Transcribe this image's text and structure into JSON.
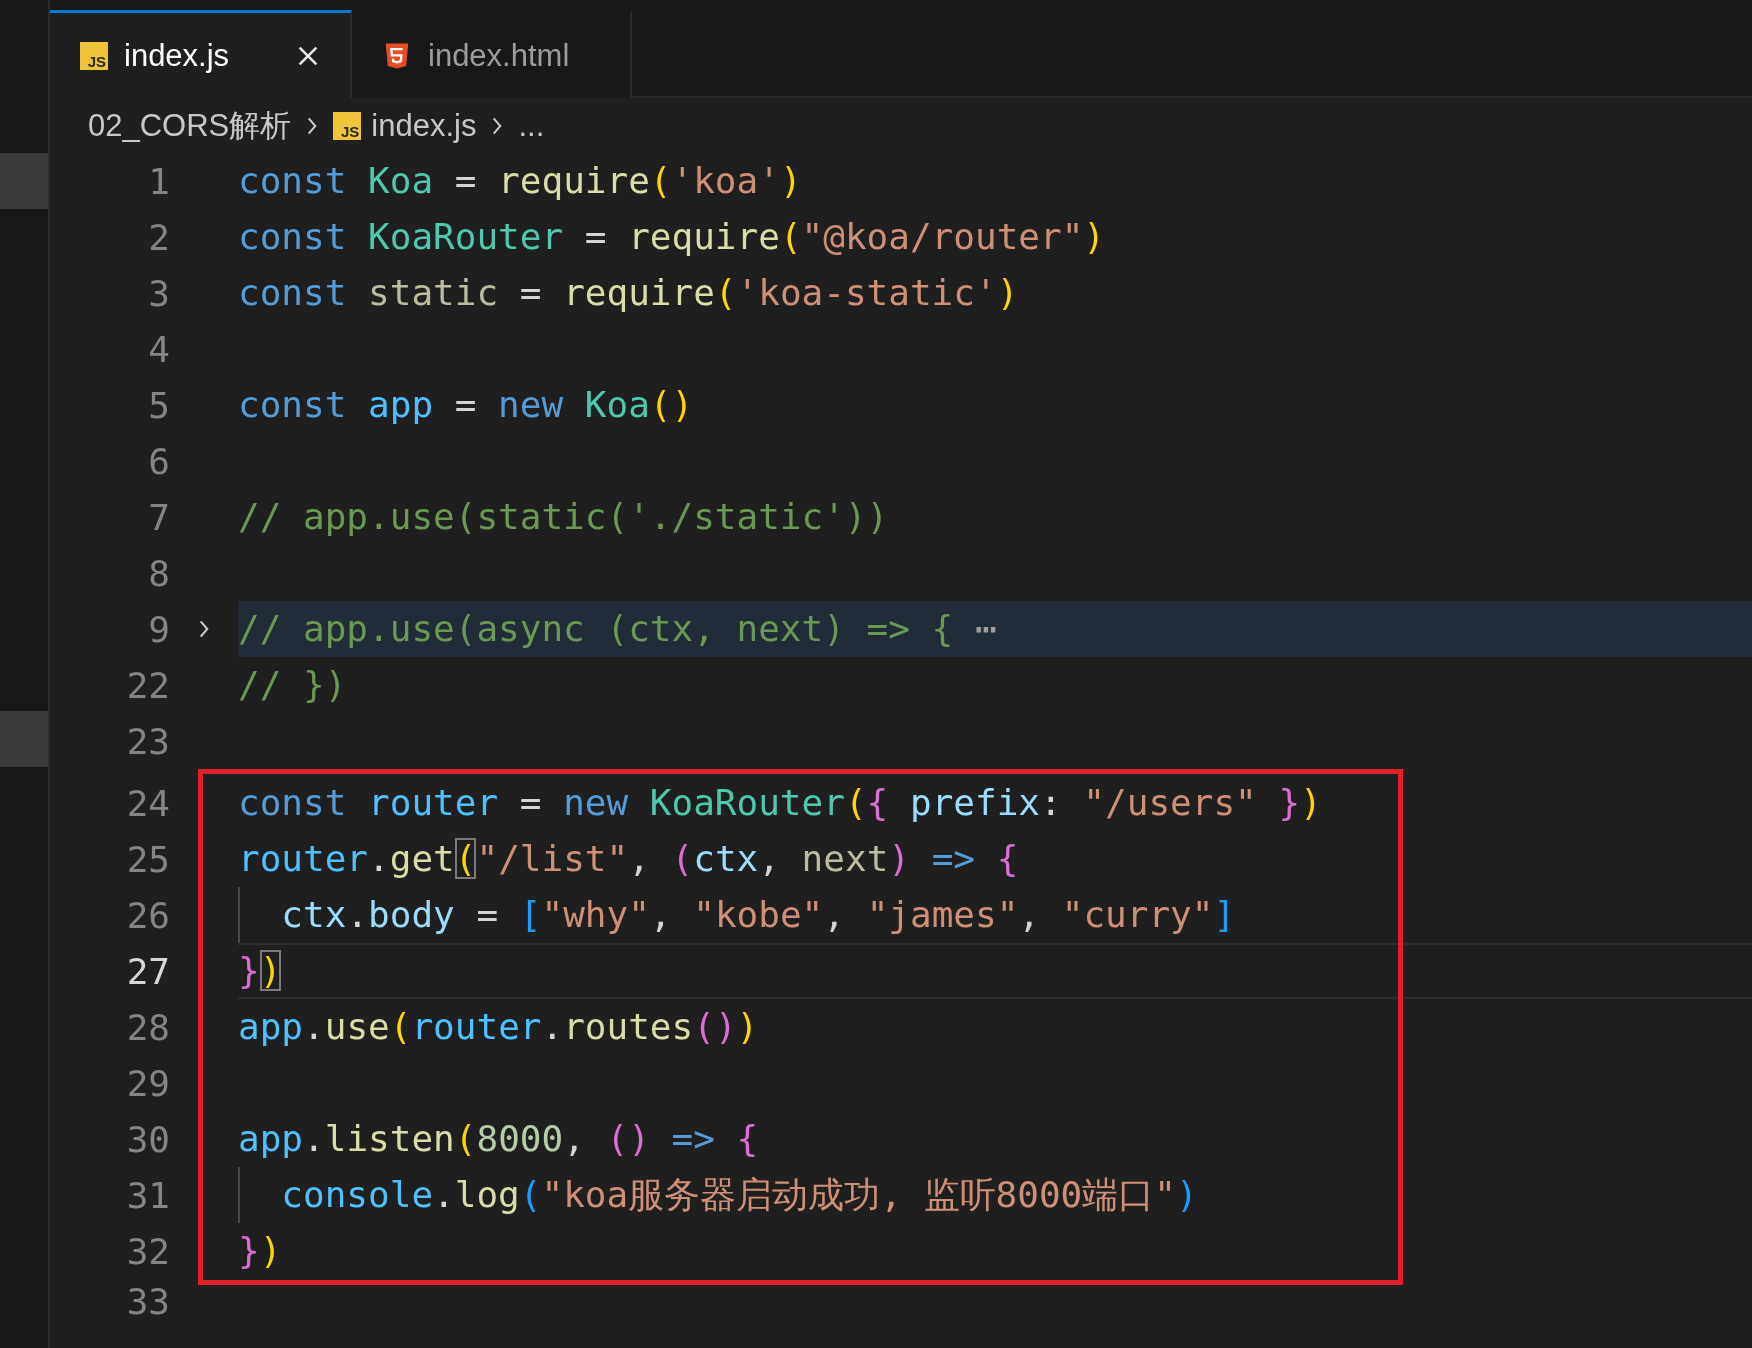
{
  "tabs": [
    {
      "label": "index.js",
      "kind": "js",
      "icon_text": "JS",
      "selected": true
    },
    {
      "label": "index.html",
      "kind": "html",
      "selected": false
    }
  ],
  "breadcrumb": [
    {
      "label": "02_CORS解析",
      "kind": "folder"
    },
    {
      "label": "index.js",
      "kind": "js",
      "icon_text": "JS"
    },
    {
      "label": "...",
      "kind": "symbol"
    }
  ],
  "sections": [
    {
      "boxed": false,
      "lines": [
        {
          "number": "1",
          "folded": false,
          "current": false,
          "tokens": [
            {
              "text": "const",
              "kind": "keyword"
            },
            {
              "text": " Koa",
              "kind": "class"
            },
            {
              "text": " = ",
              "kind": "plain"
            },
            {
              "text": "require",
              "kind": "function"
            },
            {
              "text": "(",
              "kind": "bracket1"
            },
            {
              "text": "'koa'",
              "kind": "string"
            },
            {
              "text": ")",
              "kind": "bracket1"
            }
          ]
        },
        {
          "number": "2",
          "folded": false,
          "current": false,
          "tokens": [
            {
              "text": "const",
              "kind": "keyword"
            },
            {
              "text": " KoaRouter",
              "kind": "class"
            },
            {
              "text": " = ",
              "kind": "plain"
            },
            {
              "text": "require",
              "kind": "function"
            },
            {
              "text": "(",
              "kind": "bracket1"
            },
            {
              "text": "\"@koa/router\"",
              "kind": "string"
            },
            {
              "text": ")",
              "kind": "bracket1"
            }
          ]
        },
        {
          "number": "3",
          "folded": false,
          "current": false,
          "tokens": [
            {
              "text": "const",
              "kind": "keyword"
            },
            {
              "text": " static",
              "kind": "unused"
            },
            {
              "text": " = ",
              "kind": "plain"
            },
            {
              "text": "require",
              "kind": "function"
            },
            {
              "text": "(",
              "kind": "bracket1"
            },
            {
              "text": "'koa-static'",
              "kind": "string"
            },
            {
              "text": ")",
              "kind": "bracket1"
            }
          ]
        },
        {
          "number": "4",
          "folded": false,
          "current": false
        },
        {
          "number": "5",
          "folded": false,
          "current": false,
          "tokens": [
            {
              "text": "const",
              "kind": "keyword"
            },
            {
              "text": " app",
              "kind": "variable"
            },
            {
              "text": " = ",
              "kind": "plain"
            },
            {
              "text": "new",
              "kind": "keyword"
            },
            {
              "text": " Koa",
              "kind": "class"
            },
            {
              "text": "()",
              "kind": "bracket1"
            }
          ]
        },
        {
          "number": "6",
          "folded": false,
          "current": false
        },
        {
          "number": "7",
          "folded": false,
          "current": false,
          "tokens": [
            {
              "text": "// app.use(static('./static'))",
              "kind": "comment"
            }
          ]
        },
        {
          "number": "8",
          "folded": false,
          "current": false
        },
        {
          "number": "9",
          "folded": true,
          "current": false,
          "tokens": [
            {
              "text": "// app.use(async (ctx, next) => {",
              "kind": "comment"
            },
            {
              "text": " ⋯",
              "kind": "ellipsis"
            }
          ]
        },
        {
          "number": "22",
          "folded": false,
          "current": false,
          "tokens": [
            {
              "text": "// })",
              "kind": "comment"
            }
          ]
        },
        {
          "number": "23",
          "folded": false,
          "current": false
        }
      ]
    },
    {
      "boxed": true,
      "lines": [
        {
          "number": "24",
          "folded": false,
          "current": false,
          "tokens": [
            {
              "text": "const",
              "kind": "keyword"
            },
            {
              "text": " router",
              "kind": "variable"
            },
            {
              "text": " = ",
              "kind": "plain"
            },
            {
              "text": "new",
              "kind": "keyword"
            },
            {
              "text": " KoaRouter",
              "kind": "class"
            },
            {
              "text": "(",
              "kind": "bracket1"
            },
            {
              "text": "{",
              "kind": "bracket2"
            },
            {
              "text": " prefix",
              "kind": "property"
            },
            {
              "text": ": ",
              "kind": "plain"
            },
            {
              "text": "\"/users\"",
              "kind": "string"
            },
            {
              "text": " }",
              "kind": "bracket2"
            },
            {
              "text": ")",
              "kind": "bracket1"
            }
          ]
        },
        {
          "number": "25",
          "folded": false,
          "current": false,
          "tokens": [
            {
              "text": "router",
              "kind": "variable"
            },
            {
              "text": ".",
              "kind": "plain"
            },
            {
              "text": "get",
              "kind": "function"
            },
            {
              "text": "(",
              "kind": "bracket1-match"
            },
            {
              "text": "\"/list\"",
              "kind": "string"
            },
            {
              "text": ", ",
              "kind": "plain"
            },
            {
              "text": "(",
              "kind": "bracket2"
            },
            {
              "text": "ctx",
              "kind": "property"
            },
            {
              "text": ", ",
              "kind": "plain"
            },
            {
              "text": "next",
              "kind": "unused"
            },
            {
              "text": ")",
              "kind": "bracket2"
            },
            {
              "text": " =>",
              "kind": "keyword"
            },
            {
              "text": " {",
              "kind": "bracket2"
            }
          ]
        },
        {
          "number": "26",
          "folded": false,
          "current": false,
          "tokens": [
            {
              "text": "  ctx",
              "kind": "property"
            },
            {
              "text": ".",
              "kind": "plain"
            },
            {
              "text": "body",
              "kind": "property"
            },
            {
              "text": " = ",
              "kind": "plain"
            },
            {
              "text": "[",
              "kind": "bracket3"
            },
            {
              "text": "\"why\"",
              "kind": "string"
            },
            {
              "text": ", ",
              "kind": "plain"
            },
            {
              "text": "\"kobe\"",
              "kind": "string"
            },
            {
              "text": ", ",
              "kind": "plain"
            },
            {
              "text": "\"james\"",
              "kind": "string"
            },
            {
              "text": ", ",
              "kind": "plain"
            },
            {
              "text": "\"curry\"",
              "kind": "string"
            },
            {
              "text": "]",
              "kind": "bracket3"
            }
          ]
        },
        {
          "number": "27",
          "folded": false,
          "current": true,
          "tokens": [
            {
              "text": "}",
              "kind": "bracket2"
            },
            {
              "text": ")",
              "kind": "bracket1-match"
            }
          ]
        },
        {
          "number": "28",
          "folded": false,
          "current": false,
          "tokens": [
            {
              "text": "app",
              "kind": "variable"
            },
            {
              "text": ".",
              "kind": "plain"
            },
            {
              "text": "use",
              "kind": "function"
            },
            {
              "text": "(",
              "kind": "bracket1"
            },
            {
              "text": "router",
              "kind": "variable"
            },
            {
              "text": ".",
              "kind": "plain"
            },
            {
              "text": "routes",
              "kind": "function"
            },
            {
              "text": "()",
              "kind": "bracket2"
            },
            {
              "text": ")",
              "kind": "bracket1"
            }
          ]
        },
        {
          "number": "29",
          "folded": false,
          "current": false
        },
        {
          "number": "30",
          "folded": false,
          "current": false,
          "tokens": [
            {
              "text": "app",
              "kind": "variable"
            },
            {
              "text": ".",
              "kind": "plain"
            },
            {
              "text": "listen",
              "kind": "function"
            },
            {
              "text": "(",
              "kind": "bracket1"
            },
            {
              "text": "8000",
              "kind": "number"
            },
            {
              "text": ", ",
              "kind": "plain"
            },
            {
              "text": "()",
              "kind": "bracket2"
            },
            {
              "text": " =>",
              "kind": "keyword"
            },
            {
              "text": " {",
              "kind": "bracket2"
            }
          ]
        },
        {
          "number": "31",
          "folded": false,
          "current": false,
          "tokens": [
            {
              "text": "  console",
              "kind": "variable"
            },
            {
              "text": ".",
              "kind": "plain"
            },
            {
              "text": "log",
              "kind": "function"
            },
            {
              "text": "(",
              "kind": "bracket3"
            },
            {
              "text": "\"koa服务器启动成功, 监听8000端口\"",
              "kind": "string"
            },
            {
              "text": ")",
              "kind": "bracket3"
            }
          ]
        },
        {
          "number": "32",
          "folded": false,
          "current": false,
          "tokens": [
            {
              "text": "}",
              "kind": "bracket2"
            },
            {
              "text": ")",
              "kind": "bracket1"
            }
          ]
        }
      ]
    },
    {
      "boxed": false,
      "lines": [
        {
          "number": "33",
          "folded": false,
          "current": false
        }
      ]
    }
  ]
}
